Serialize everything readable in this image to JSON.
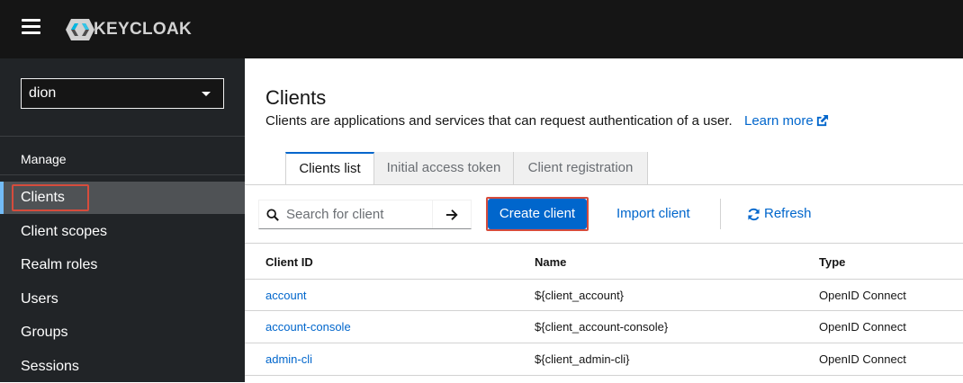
{
  "header": {
    "brand": "KEYCLOAK"
  },
  "sidebar": {
    "realm": "dion",
    "section": "Manage",
    "items": [
      {
        "label": "Clients"
      },
      {
        "label": "Client scopes"
      },
      {
        "label": "Realm roles"
      },
      {
        "label": "Users"
      },
      {
        "label": "Groups"
      },
      {
        "label": "Sessions"
      }
    ]
  },
  "main": {
    "title": "Clients",
    "description": "Clients are applications and services that can request authentication of a user.",
    "learn_more": "Learn more",
    "tabs": [
      {
        "label": "Clients list"
      },
      {
        "label": "Initial access token"
      },
      {
        "label": "Client registration"
      }
    ],
    "search": {
      "placeholder": "Search for client"
    },
    "buttons": {
      "create": "Create client",
      "import": "Import client",
      "refresh": "Refresh"
    },
    "table": {
      "headers": [
        "Client ID",
        "Name",
        "Type"
      ],
      "rows": [
        [
          "account",
          "${client_account}",
          "OpenID Connect"
        ],
        [
          "account-console",
          "${client_account-console}",
          "OpenID Connect"
        ],
        [
          "admin-cli",
          "${client_admin-cli}",
          "OpenID Connect"
        ]
      ]
    }
  },
  "colors": {
    "accent": "#0066cc",
    "highlight": "#d64c3c",
    "masthead": "#151515",
    "sidebar": "#212427"
  }
}
